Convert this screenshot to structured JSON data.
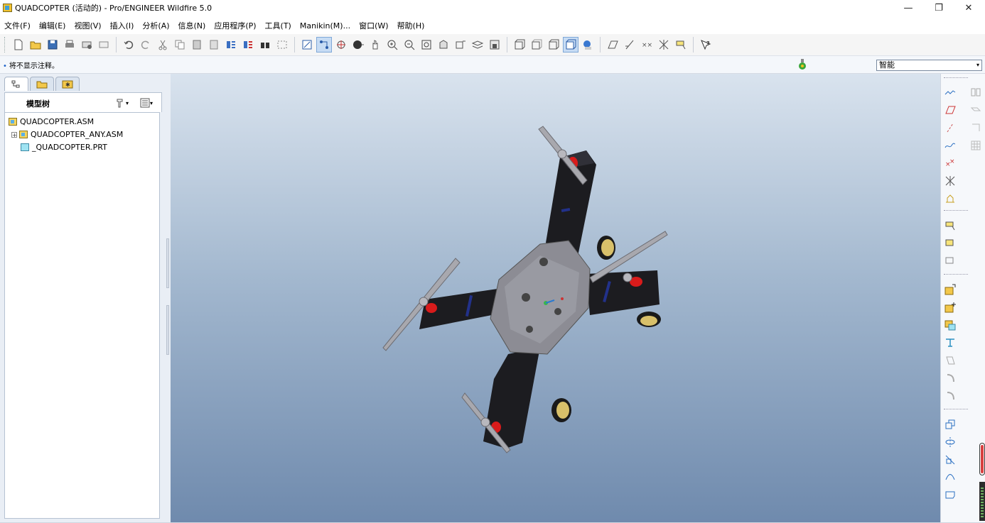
{
  "window": {
    "title": "QUADCOPTER (活动的) - Pro/ENGINEER Wildfire 5.0",
    "minimize_glyph": "—",
    "maximize_glyph": "❐",
    "close_glyph": "✕"
  },
  "menu": [
    "文件(F)",
    "编辑(E)",
    "视图(V)",
    "插入(I)",
    "分析(A)",
    "信息(N)",
    "应用程序(P)",
    "工具(T)",
    "Manikin(M)...",
    "窗口(W)",
    "帮助(H)"
  ],
  "message_bar": {
    "bullet": "•",
    "text": "将不显示注释。"
  },
  "filter": {
    "value": "智能",
    "arrow": "▾"
  },
  "model_tree": {
    "header": "模型树",
    "items": [
      {
        "label": "QUADCOPTER.ASM",
        "icon": "assembly-icon"
      },
      {
        "label": "QUADCOPTER_ANY.ASM",
        "icon": "assembly-icon"
      },
      {
        "label": "_QUADCOPTER.PRT",
        "icon": "part-icon"
      }
    ]
  },
  "colors": {
    "bg_top": "#d9e3ee",
    "bg_bottom": "#6f8aad",
    "frame": "#1c1c20",
    "plate": "#8c8c94",
    "motor": "#d81b1b",
    "wheel": "#d8c06a"
  }
}
